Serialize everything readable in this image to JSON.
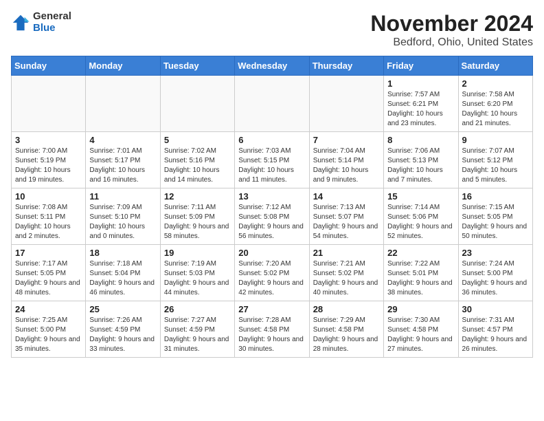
{
  "header": {
    "logo_general": "General",
    "logo_blue": "Blue",
    "month_title": "November 2024",
    "location": "Bedford, Ohio, United States"
  },
  "weekdays": [
    "Sunday",
    "Monday",
    "Tuesday",
    "Wednesday",
    "Thursday",
    "Friday",
    "Saturday"
  ],
  "weeks": [
    [
      {
        "day": "",
        "info": ""
      },
      {
        "day": "",
        "info": ""
      },
      {
        "day": "",
        "info": ""
      },
      {
        "day": "",
        "info": ""
      },
      {
        "day": "",
        "info": ""
      },
      {
        "day": "1",
        "info": "Sunrise: 7:57 AM\nSunset: 6:21 PM\nDaylight: 10 hours and 23 minutes."
      },
      {
        "day": "2",
        "info": "Sunrise: 7:58 AM\nSunset: 6:20 PM\nDaylight: 10 hours and 21 minutes."
      }
    ],
    [
      {
        "day": "3",
        "info": "Sunrise: 7:00 AM\nSunset: 5:19 PM\nDaylight: 10 hours and 19 minutes."
      },
      {
        "day": "4",
        "info": "Sunrise: 7:01 AM\nSunset: 5:17 PM\nDaylight: 10 hours and 16 minutes."
      },
      {
        "day": "5",
        "info": "Sunrise: 7:02 AM\nSunset: 5:16 PM\nDaylight: 10 hours and 14 minutes."
      },
      {
        "day": "6",
        "info": "Sunrise: 7:03 AM\nSunset: 5:15 PM\nDaylight: 10 hours and 11 minutes."
      },
      {
        "day": "7",
        "info": "Sunrise: 7:04 AM\nSunset: 5:14 PM\nDaylight: 10 hours and 9 minutes."
      },
      {
        "day": "8",
        "info": "Sunrise: 7:06 AM\nSunset: 5:13 PM\nDaylight: 10 hours and 7 minutes."
      },
      {
        "day": "9",
        "info": "Sunrise: 7:07 AM\nSunset: 5:12 PM\nDaylight: 10 hours and 5 minutes."
      }
    ],
    [
      {
        "day": "10",
        "info": "Sunrise: 7:08 AM\nSunset: 5:11 PM\nDaylight: 10 hours and 2 minutes."
      },
      {
        "day": "11",
        "info": "Sunrise: 7:09 AM\nSunset: 5:10 PM\nDaylight: 10 hours and 0 minutes."
      },
      {
        "day": "12",
        "info": "Sunrise: 7:11 AM\nSunset: 5:09 PM\nDaylight: 9 hours and 58 minutes."
      },
      {
        "day": "13",
        "info": "Sunrise: 7:12 AM\nSunset: 5:08 PM\nDaylight: 9 hours and 56 minutes."
      },
      {
        "day": "14",
        "info": "Sunrise: 7:13 AM\nSunset: 5:07 PM\nDaylight: 9 hours and 54 minutes."
      },
      {
        "day": "15",
        "info": "Sunrise: 7:14 AM\nSunset: 5:06 PM\nDaylight: 9 hours and 52 minutes."
      },
      {
        "day": "16",
        "info": "Sunrise: 7:15 AM\nSunset: 5:05 PM\nDaylight: 9 hours and 50 minutes."
      }
    ],
    [
      {
        "day": "17",
        "info": "Sunrise: 7:17 AM\nSunset: 5:05 PM\nDaylight: 9 hours and 48 minutes."
      },
      {
        "day": "18",
        "info": "Sunrise: 7:18 AM\nSunset: 5:04 PM\nDaylight: 9 hours and 46 minutes."
      },
      {
        "day": "19",
        "info": "Sunrise: 7:19 AM\nSunset: 5:03 PM\nDaylight: 9 hours and 44 minutes."
      },
      {
        "day": "20",
        "info": "Sunrise: 7:20 AM\nSunset: 5:02 PM\nDaylight: 9 hours and 42 minutes."
      },
      {
        "day": "21",
        "info": "Sunrise: 7:21 AM\nSunset: 5:02 PM\nDaylight: 9 hours and 40 minutes."
      },
      {
        "day": "22",
        "info": "Sunrise: 7:22 AM\nSunset: 5:01 PM\nDaylight: 9 hours and 38 minutes."
      },
      {
        "day": "23",
        "info": "Sunrise: 7:24 AM\nSunset: 5:00 PM\nDaylight: 9 hours and 36 minutes."
      }
    ],
    [
      {
        "day": "24",
        "info": "Sunrise: 7:25 AM\nSunset: 5:00 PM\nDaylight: 9 hours and 35 minutes."
      },
      {
        "day": "25",
        "info": "Sunrise: 7:26 AM\nSunset: 4:59 PM\nDaylight: 9 hours and 33 minutes."
      },
      {
        "day": "26",
        "info": "Sunrise: 7:27 AM\nSunset: 4:59 PM\nDaylight: 9 hours and 31 minutes."
      },
      {
        "day": "27",
        "info": "Sunrise: 7:28 AM\nSunset: 4:58 PM\nDaylight: 9 hours and 30 minutes."
      },
      {
        "day": "28",
        "info": "Sunrise: 7:29 AM\nSunset: 4:58 PM\nDaylight: 9 hours and 28 minutes."
      },
      {
        "day": "29",
        "info": "Sunrise: 7:30 AM\nSunset: 4:58 PM\nDaylight: 9 hours and 27 minutes."
      },
      {
        "day": "30",
        "info": "Sunrise: 7:31 AM\nSunset: 4:57 PM\nDaylight: 9 hours and 26 minutes."
      }
    ]
  ]
}
